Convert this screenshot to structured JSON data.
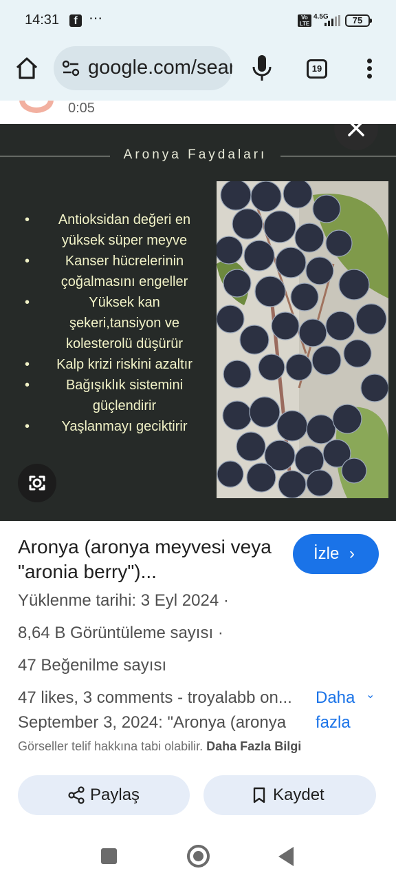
{
  "status_bar": {
    "time": "14:31",
    "notification_icon": "facebook-icon",
    "more_icon": "⋯",
    "volte": "Vo LTE",
    "network": "4.5G",
    "battery": "75"
  },
  "browser": {
    "url": "google.com/search",
    "tab_count": "19",
    "icons": [
      "home-icon",
      "site-settings-icon",
      "mic-icon",
      "tabs-icon",
      "more-vert-icon"
    ]
  },
  "behind": {
    "time": "0:05"
  },
  "image": {
    "title": "Aronya Faydaları",
    "benefits": [
      "Antioksidan değeri en yüksek süper meyve",
      "Kanser hücrelerinin çoğalmasını engeller",
      "Yüksek kan şekeri,tansiyon ve kolesterolü düşürür",
      "Kalp krizi riskini azaltır",
      "Bağışıklık sistemini güçlendirir",
      "Yaşlanmayı geciktirir"
    ]
  },
  "details": {
    "title": "Aronya (aronya meyvesi veya \"aronia berry\")...",
    "watch_label": "İzle",
    "upload": "Yüklenme tarihi: 3 Eyl 2024",
    "views": "8,64 B Görüntüleme sayısı",
    "likes": "47 Beğenilme sayısı",
    "dot": "·",
    "description_line1": "47 likes, 3 comments - troyalabb on...",
    "description_line2": "September 3, 2024: \"Aronya (aronya",
    "more_label": "Daha fazla",
    "copyright": "Görseller telif hakkına tabi olabilir.",
    "copyright_link": "Daha Fazla Bilgi",
    "share_label": "Paylaş",
    "save_label": "Kaydet"
  },
  "colors": {
    "accent": "#1a73e8",
    "panel_bg": "#262a28",
    "benefit_text": "#f1f2c7",
    "chrome_bg": "#e9f3f7"
  }
}
